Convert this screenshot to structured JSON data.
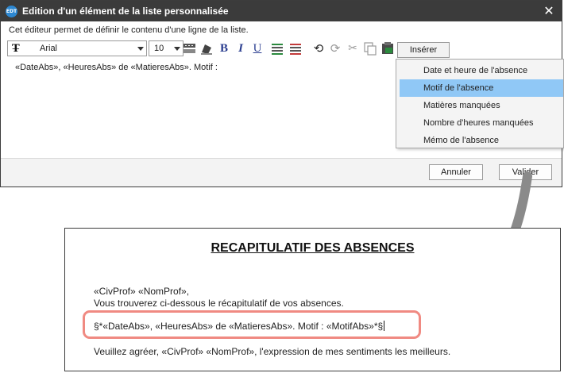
{
  "dialog": {
    "title": "Edition d'un élément de la liste personnalisée",
    "app_logo_text": "EDT",
    "description": "Cet éditeur permet de définir le contenu d'une ligne de la liste.",
    "toolbar": {
      "font_name": "Arial",
      "font_size": "10",
      "insert_label": "Insérer",
      "icons": [
        "font-icon",
        "spellcheck-icon",
        "highlighter-icon",
        "bold-icon",
        "italic-icon",
        "underline-icon",
        "text-color-icon",
        "background-color-icon",
        "undo-icon",
        "redo-icon",
        "cut-icon",
        "copy-icon",
        "paste-icon"
      ]
    },
    "editor_text": "«DateAbs», «HeuresAbs» de «MatieresAbs». Motif :",
    "insert_menu": {
      "items": [
        {
          "label": "Date et heure de l'absence",
          "selected": false
        },
        {
          "label": "Motif de l'absence",
          "selected": true
        },
        {
          "label": "Matières manquées",
          "selected": false
        },
        {
          "label": "Nombre d'heures manquées",
          "selected": false
        },
        {
          "label": "Mémo de l'absence",
          "selected": false
        }
      ]
    },
    "cancel_label": "Annuler",
    "validate_label": "Valider"
  },
  "letter": {
    "title": "RECAPITULATIF DES ABSENCES",
    "greeting": "«CivProf» «NomProf»,",
    "intro": "Vous trouverez ci-dessous le récapitulatif de vos absences.",
    "list_line": "§*«DateAbs», «HeuresAbs» de «MatieresAbs». Motif : «MotifAbs»*§",
    "closing": "Veuillez agréer, «CivProf» «NomProf», l'expression de mes sentiments les meilleurs."
  },
  "colors": {
    "titlebar": "#3b3b3b",
    "selection": "#90c8f6",
    "highlight_border": "#f08a82",
    "connector_arrow": "#8a8a8a"
  }
}
